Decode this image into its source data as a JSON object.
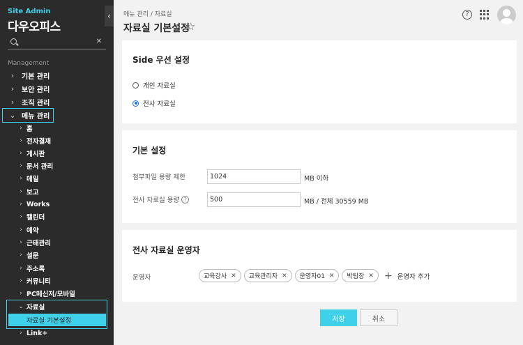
{
  "sidebar": {
    "site_admin": "Site Admin",
    "brand": "다우오피스",
    "search_placeholder": "",
    "section_label": "Management",
    "top_items": [
      {
        "label": "기본 관리"
      },
      {
        "label": "보안 관리"
      },
      {
        "label": "조직 관리"
      },
      {
        "label": "메뉴 관리"
      }
    ],
    "sub_items": [
      {
        "label": "홈"
      },
      {
        "label": "전자결재"
      },
      {
        "label": "게시판"
      },
      {
        "label": "문서 관리"
      },
      {
        "label": "메일"
      },
      {
        "label": "보고"
      },
      {
        "label": "Works"
      },
      {
        "label": "캘린더"
      },
      {
        "label": "예약"
      },
      {
        "label": "근태관리"
      },
      {
        "label": "설문"
      },
      {
        "label": "주소록"
      },
      {
        "label": "커뮤니티"
      },
      {
        "label": "PC메신저/모바일"
      },
      {
        "label": "자료실"
      },
      {
        "label": "Link+"
      }
    ],
    "active_sub": "자료실 기본설정"
  },
  "header": {
    "breadcrumb": "메뉴 관리 / 자료실",
    "title": "자료실 기본설정"
  },
  "side_priority": {
    "title": "Side 우선 설정",
    "options": [
      {
        "label": "개인 자료실",
        "checked": false
      },
      {
        "label": "전사 자료실",
        "checked": true
      }
    ]
  },
  "basic": {
    "title": "기본 설정",
    "attach_label": "첨부파일 용량 제한",
    "attach_value": "1024",
    "attach_suffix": "MB 이하",
    "capacity_label": "전사 자료실 용량",
    "capacity_value": "500",
    "capacity_suffix": "MB / 전체 30559 MB"
  },
  "operators": {
    "title": "전사 자료실 운영자",
    "label": "운영자",
    "tags": [
      "교육강사",
      "교육관리자",
      "운영자01",
      "박팀장"
    ],
    "add_label": "운영자 추가"
  },
  "actions": {
    "save": "저장",
    "cancel": "취소"
  },
  "colors": {
    "accent": "#3fd0ea",
    "sidebar_bg": "#2b2b2b"
  }
}
